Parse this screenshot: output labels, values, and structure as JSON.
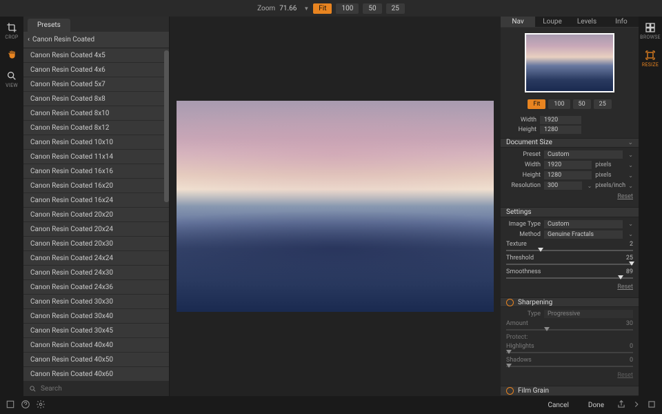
{
  "topbar": {
    "zoom_label": "Zoom",
    "zoom_value": "71.66",
    "zoom_buttons": [
      "Fit",
      "100",
      "50",
      "25"
    ],
    "zoom_active": "Fit"
  },
  "left_tools": [
    {
      "name": "crop",
      "label": "CROP"
    },
    {
      "name": "hand",
      "label": ""
    },
    {
      "name": "view",
      "label": "VIEW"
    }
  ],
  "presets": {
    "tab_label": "Presets",
    "header": "Canon Resin Coated",
    "items": [
      "Canon Resin Coated 4x5",
      "Canon Resin Coated 4x6",
      "Canon Resin Coated 5x7",
      "Canon Resin Coated 8x8",
      "Canon Resin Coated 8x10",
      "Canon Resin Coated 8x12",
      "Canon Resin Coated 10x10",
      "Canon Resin Coated 11x14",
      "Canon Resin Coated 16x16",
      "Canon Resin Coated 16x20",
      "Canon Resin Coated 16x24",
      "Canon Resin Coated 20x20",
      "Canon Resin Coated 20x24",
      "Canon Resin Coated 20x30",
      "Canon Resin Coated 24x24",
      "Canon Resin Coated 24x30",
      "Canon Resin Coated 24x36",
      "Canon Resin Coated 30x30",
      "Canon Resin Coated 30x40",
      "Canon Resin Coated 30x45",
      "Canon Resin Coated 40x40",
      "Canon Resin Coated 40x50",
      "Canon Resin Coated 40x60"
    ],
    "search_placeholder": "Search"
  },
  "right_tabs": [
    "Nav",
    "Loupe",
    "Levels",
    "Info"
  ],
  "right_tab_active": "Nav",
  "nav_zoom_buttons": [
    "Fit",
    "100",
    "50",
    "25"
  ],
  "nav_zoom_active": "Fit",
  "image_dims": {
    "width_label": "Width",
    "width_value": "1920",
    "height_label": "Height",
    "height_value": "1280"
  },
  "doc_size": {
    "title": "Document Size",
    "preset_label": "Preset",
    "preset_value": "Custom",
    "width_label": "Width",
    "width_value": "1920",
    "width_unit": "pixels",
    "height_label": "Height",
    "height_value": "1280",
    "height_unit": "pixels",
    "res_label": "Resolution",
    "res_value": "300",
    "res_unit": "pixels/inch",
    "reset": "Reset"
  },
  "settings": {
    "title": "Settings",
    "image_type_label": "Image Type",
    "image_type_value": "Custom",
    "method_label": "Method",
    "method_value": "Genuine Fractals",
    "texture_label": "Texture",
    "texture_value": "2",
    "threshold_label": "Threshold",
    "threshold_value": "25",
    "smoothness_label": "Smoothness",
    "smoothness_value": "89",
    "reset": "Reset"
  },
  "sharpening": {
    "title": "Sharpening",
    "type_label": "Type",
    "type_value": "Progressive",
    "amount_label": "Amount",
    "amount_value": "30",
    "protect_label": "Protect:",
    "highlights_label": "Highlights",
    "highlights_value": "0",
    "shadows_label": "Shadows",
    "shadows_value": "0",
    "reset": "Reset"
  },
  "film_grain": {
    "title": "Film Grain"
  },
  "right_tools": [
    {
      "name": "browse",
      "label": "BROWSE"
    },
    {
      "name": "resize",
      "label": "RESIZE",
      "active": true
    }
  ],
  "bottombar": {
    "cancel": "Cancel",
    "done": "Done"
  }
}
